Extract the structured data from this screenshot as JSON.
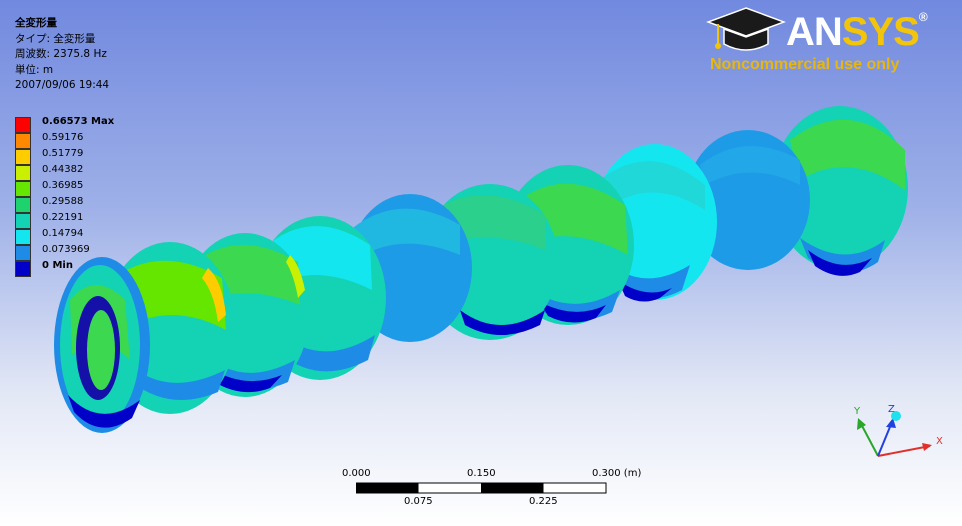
{
  "result": {
    "title": "全変形量",
    "type_line": "タイプ: 全変形量",
    "frequency_line": "周波数: 2375.8 Hz",
    "unit_line": "単位: m",
    "timestamp": "2007/09/06 19:44"
  },
  "legend": {
    "entries": [
      {
        "label": "0.66573 Max",
        "color": "#ff0000",
        "bold": true
      },
      {
        "label": "0.59176",
        "color": "#ff8800",
        "bold": false
      },
      {
        "label": "0.51779",
        "color": "#ffcc00",
        "bold": false
      },
      {
        "label": "0.44382",
        "color": "#c8f000",
        "bold": false
      },
      {
        "label": "0.36985",
        "color": "#64e600",
        "bold": false
      },
      {
        "label": "0.29588",
        "color": "#1ed26e",
        "bold": false
      },
      {
        "label": "0.22191",
        "color": "#14d2b4",
        "bold": false
      },
      {
        "label": "0.14794",
        "color": "#14e6f0",
        "bold": false
      },
      {
        "label": "0.073969",
        "color": "#1e8ce6",
        "bold": false
      },
      {
        "label": "0 Min",
        "color": "#0000c8",
        "bold": true
      }
    ]
  },
  "logo": {
    "brand_an": "AN",
    "brand_sys": "SYS",
    "registered": "®",
    "subtitle": "Noncommercial use only"
  },
  "scale_bar": {
    "top_labels": [
      "0.000",
      "0.150",
      "0.300 (m)"
    ],
    "bottom_labels": [
      "0.075",
      "0.225"
    ]
  },
  "triad": {
    "x_label": "X",
    "y_label": "Y",
    "z_label": "Z"
  },
  "colors": {
    "axis_x": "#e0302a",
    "axis_y": "#2aa62a",
    "axis_z": "#2040e0"
  }
}
